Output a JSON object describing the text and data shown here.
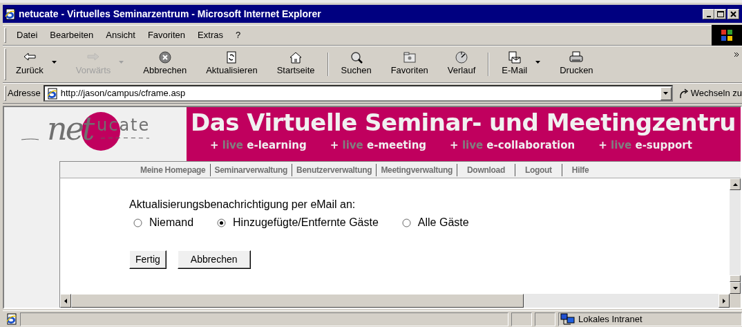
{
  "window": {
    "title": "netucate - Virtuelles Seminarzentrum - Microsoft Internet Explorer"
  },
  "menu": [
    "Datei",
    "Bearbeiten",
    "Ansicht",
    "Favoriten",
    "Extras",
    "?"
  ],
  "toolbar": [
    [
      {
        "label": "Zurück",
        "kind": "back",
        "disabled": false,
        "dropdown": true
      },
      {
        "label": "Vorwärts",
        "kind": "forward",
        "disabled": true,
        "dropdown": true
      },
      {
        "label": "Abbrechen",
        "kind": "stop",
        "disabled": false,
        "dropdown": false
      },
      {
        "label": "Aktualisieren",
        "kind": "refresh",
        "disabled": false,
        "dropdown": false
      },
      {
        "label": "Startseite",
        "kind": "home",
        "disabled": false,
        "dropdown": false
      }
    ],
    [
      {
        "label": "Suchen",
        "kind": "search",
        "disabled": false,
        "dropdown": false
      },
      {
        "label": "Favoriten",
        "kind": "favorites",
        "disabled": false,
        "dropdown": false
      },
      {
        "label": "Verlauf",
        "kind": "history",
        "disabled": false,
        "dropdown": false
      }
    ],
    [
      {
        "label": "E-Mail",
        "kind": "mail",
        "disabled": false,
        "dropdown": true
      },
      {
        "label": "Drucken",
        "kind": "print",
        "disabled": false,
        "dropdown": false
      }
    ]
  ],
  "address": {
    "label": "Adresse",
    "value": "http://jason/campus/cframe.asp",
    "go_label": "Wechseln zu"
  },
  "site": {
    "logo_script": "net",
    "logo_text": "ucate",
    "title": "Das Virtuelle Seminar- und Meetingzentru",
    "taglines": [
      {
        "plus": "+",
        "live": "live",
        "label": "e-learning"
      },
      {
        "plus": "+",
        "live": "live",
        "label": "e-meeting"
      },
      {
        "plus": "+",
        "live": "live",
        "label": "e-collaboration"
      },
      {
        "plus": "+",
        "live": "live",
        "label": "e-support"
      }
    ],
    "nav": [
      "Meine Homepage",
      "Seminarverwaltung",
      "Benutzerverwaltung",
      "Meetingverwaltung",
      "Download",
      "Logout",
      "Hilfe"
    ]
  },
  "form": {
    "prompt": "Aktualisierungsbenachrichtigung per eMail an:",
    "options": [
      {
        "label": "Niemand",
        "selected": false
      },
      {
        "label": "Hinzugefügte/Entfernte Gäste",
        "selected": true
      },
      {
        "label": "Alle Gäste",
        "selected": false
      }
    ],
    "buttons": [
      "Fertig",
      "Abbrechen"
    ]
  },
  "status_bar": {
    "zone": "Lokales Intranet"
  }
}
